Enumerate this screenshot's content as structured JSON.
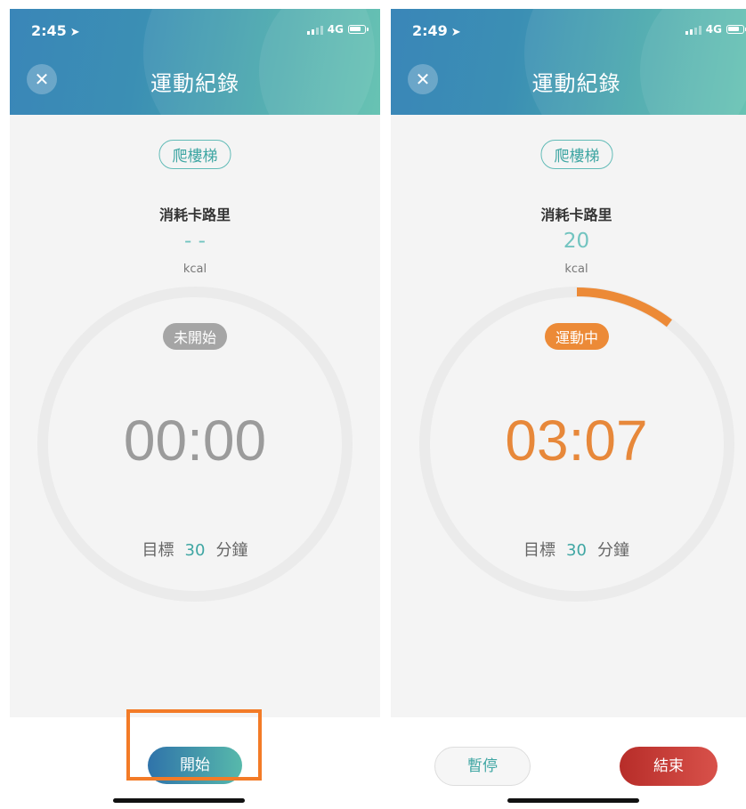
{
  "left": {
    "status": {
      "time": "2:45",
      "network": "4G"
    },
    "header": {
      "title": "運動紀錄"
    },
    "exercise_type": "爬樓梯",
    "calories": {
      "label": "消耗卡路里",
      "value": "- -",
      "unit": "kcal"
    },
    "state_badge": "未開始",
    "timer": "00:00",
    "goal": {
      "prefix": "目標",
      "minutes": "30",
      "suffix": "分鐘"
    },
    "start_button": "開始",
    "progress_fraction": 0
  },
  "right": {
    "status": {
      "time": "2:49",
      "network": "4G"
    },
    "header": {
      "title": "運動紀錄"
    },
    "exercise_type": "爬樓梯",
    "calories": {
      "label": "消耗卡路里",
      "value": "20",
      "unit": "kcal"
    },
    "state_badge": "運動中",
    "timer": "03:07",
    "goal": {
      "prefix": "目標",
      "minutes": "30",
      "suffix": "分鐘"
    },
    "pause_button": "暫停",
    "end_button": "結束",
    "progress_fraction": 0.104
  },
  "colors": {
    "accent": "#3fa6a3",
    "active": "#e7883a",
    "idle": "#9b9b9b",
    "end": "#c73a34",
    "highlight": "#f37b27"
  }
}
